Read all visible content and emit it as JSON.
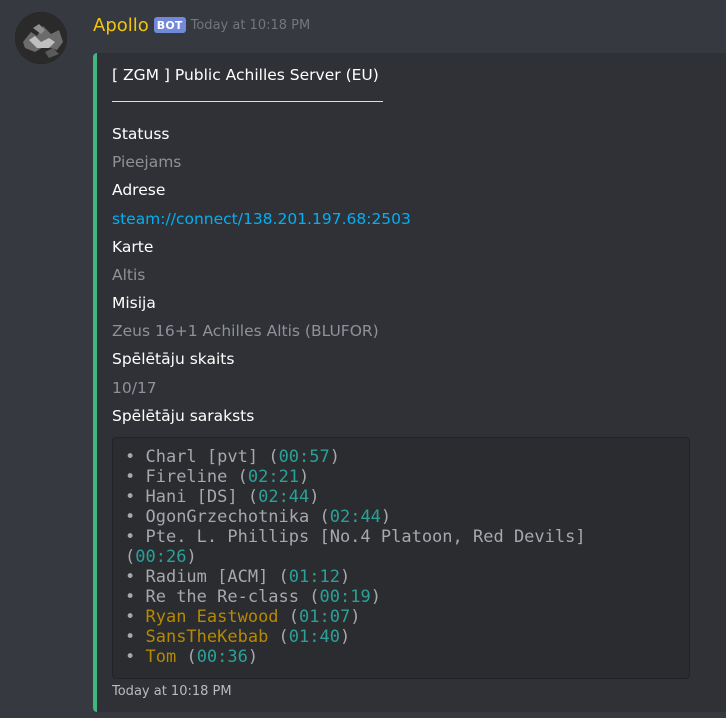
{
  "message": {
    "username": "Apollo",
    "bot_tag": "BOT",
    "timestamp": "Today at 10:18 PM"
  },
  "embed": {
    "accent_color": "#43b581",
    "title": "[ ZGM ] Public Achilles Server (EU)",
    "fields": [
      {
        "name": "Statuss",
        "value": "Pieejams"
      },
      {
        "name": "Adrese",
        "value": "steam://connect/138.201.197.68:2503"
      },
      {
        "name": "Karte",
        "value": "Altis"
      },
      {
        "name": "Misija",
        "value": "Zeus 16+1 Achilles Altis (BLUFOR)"
      },
      {
        "name": "Spēlētāju skaits",
        "value": "10/17"
      },
      {
        "name": "Spēlētāju saraksts"
      }
    ],
    "players": [
      {
        "name": "Charl [pvt]",
        "time": "00:57"
      },
      {
        "name": "Fireline",
        "time": "02:21"
      },
      {
        "name": "Hani [DS]",
        "time": "02:44"
      },
      {
        "name": "OgonGrzechotnika",
        "time": "02:44"
      },
      {
        "name": "Pte. L. Phillips [No.4 Platoon, Red Devils]",
        "time": "00:26"
      },
      {
        "name": "Radium [ACM]",
        "time": "01:12"
      },
      {
        "name": "Re the Re-class",
        "time": "00:19"
      },
      {
        "name": "Ryan Eastwood",
        "time": "01:07"
      },
      {
        "name": "SansTheKebab",
        "time": "01:40"
      },
      {
        "name": "Tom",
        "time": "00:36"
      }
    ],
    "footer_timestamp": "Today at 10:18 PM"
  }
}
